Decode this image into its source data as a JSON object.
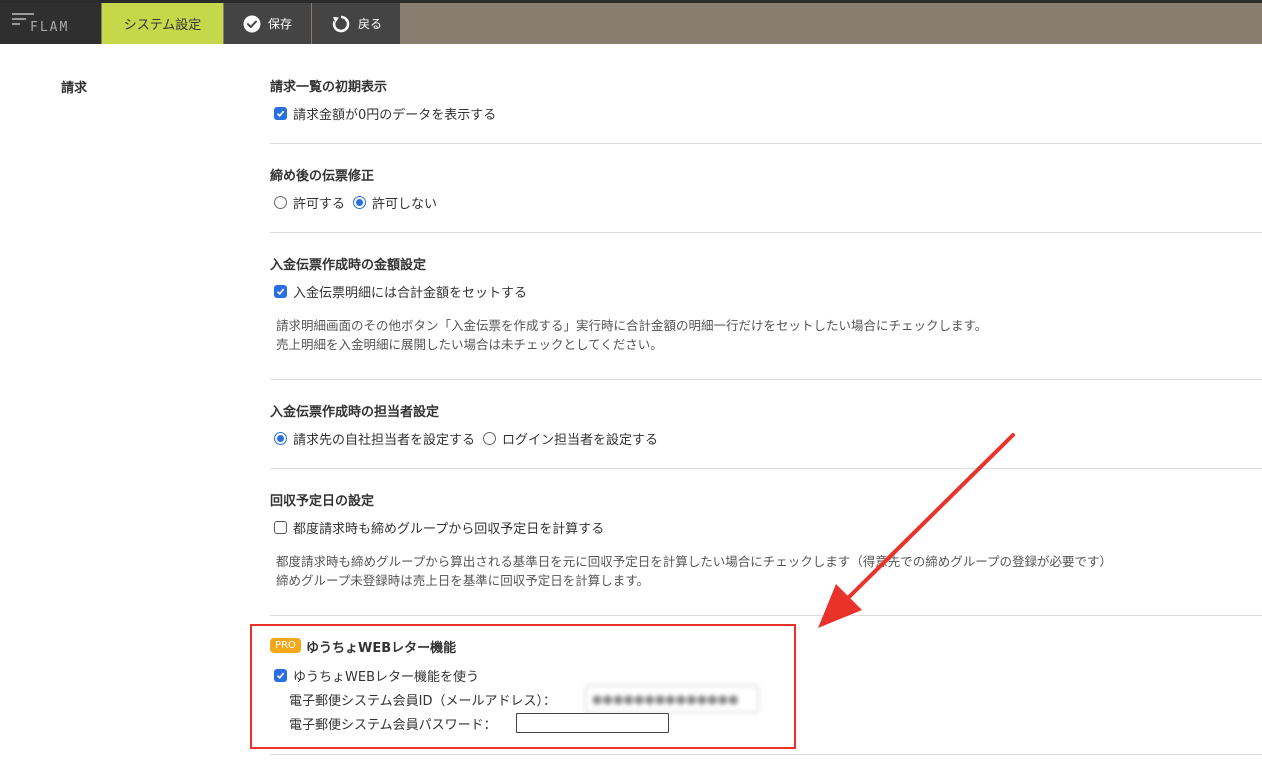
{
  "header": {
    "logo_text": "FLAM",
    "system_tab": "システム設定",
    "save_label": "保存",
    "back_label": "戻る"
  },
  "side_label": "請求",
  "sections": {
    "initial_display": {
      "title": "請求一覧の初期表示",
      "checkbox_label": "請求金額が0円のデータを表示する",
      "checked": true
    },
    "post_close_edit": {
      "title": "締め後の伝票修正",
      "options": [
        "許可する",
        "許可しない"
      ],
      "selected": "許可しない"
    },
    "payment_amount": {
      "title": "入金伝票作成時の金額設定",
      "checkbox_label": "入金伝票明細には合計金額をセットする",
      "checked": true,
      "desc_line1": "請求明細画面のその他ボタン「入金伝票を作成する」実行時に合計金額の明細一行だけをセットしたい場合にチェックします。",
      "desc_line2": "売上明細を入金明細に展開したい場合は未チェックとしてください。"
    },
    "payment_staff": {
      "title": "入金伝票作成時の担当者設定",
      "options": [
        "請求先の自社担当者を設定する",
        "ログイン担当者を設定する"
      ],
      "selected": "請求先の自社担当者を設定する"
    },
    "collection_date": {
      "title": "回収予定日の設定",
      "checkbox_label": "都度請求時も締めグループから回収予定日を計算する",
      "checked": false,
      "desc_line1": "都度請求時も締めグループから算出される基準日を元に回収予定日を計算したい場合にチェックします（得意先での締めグループの登録が必要です）",
      "desc_line2": "締めグループ未登録時は売上日を基準に回収予定日を計算します。"
    },
    "web_letter": {
      "badge": "PRO",
      "title": "ゆうちょWEBレター機能",
      "checkbox_label": "ゆうちょWEBレター機能を使う",
      "checked": true,
      "member_id_label": "電子郵便システム会員ID（メールアドレス）：",
      "member_id_value": "●●●●●●●●●●●●●●",
      "password_label": "電子郵便システム会員パスワード：",
      "password_value": ""
    }
  },
  "colors": {
    "highlight": "#e8322a",
    "accent_tab": "#c4d84a",
    "pro_badge": "#f2a81a",
    "check_blue": "#2a6fe0"
  }
}
